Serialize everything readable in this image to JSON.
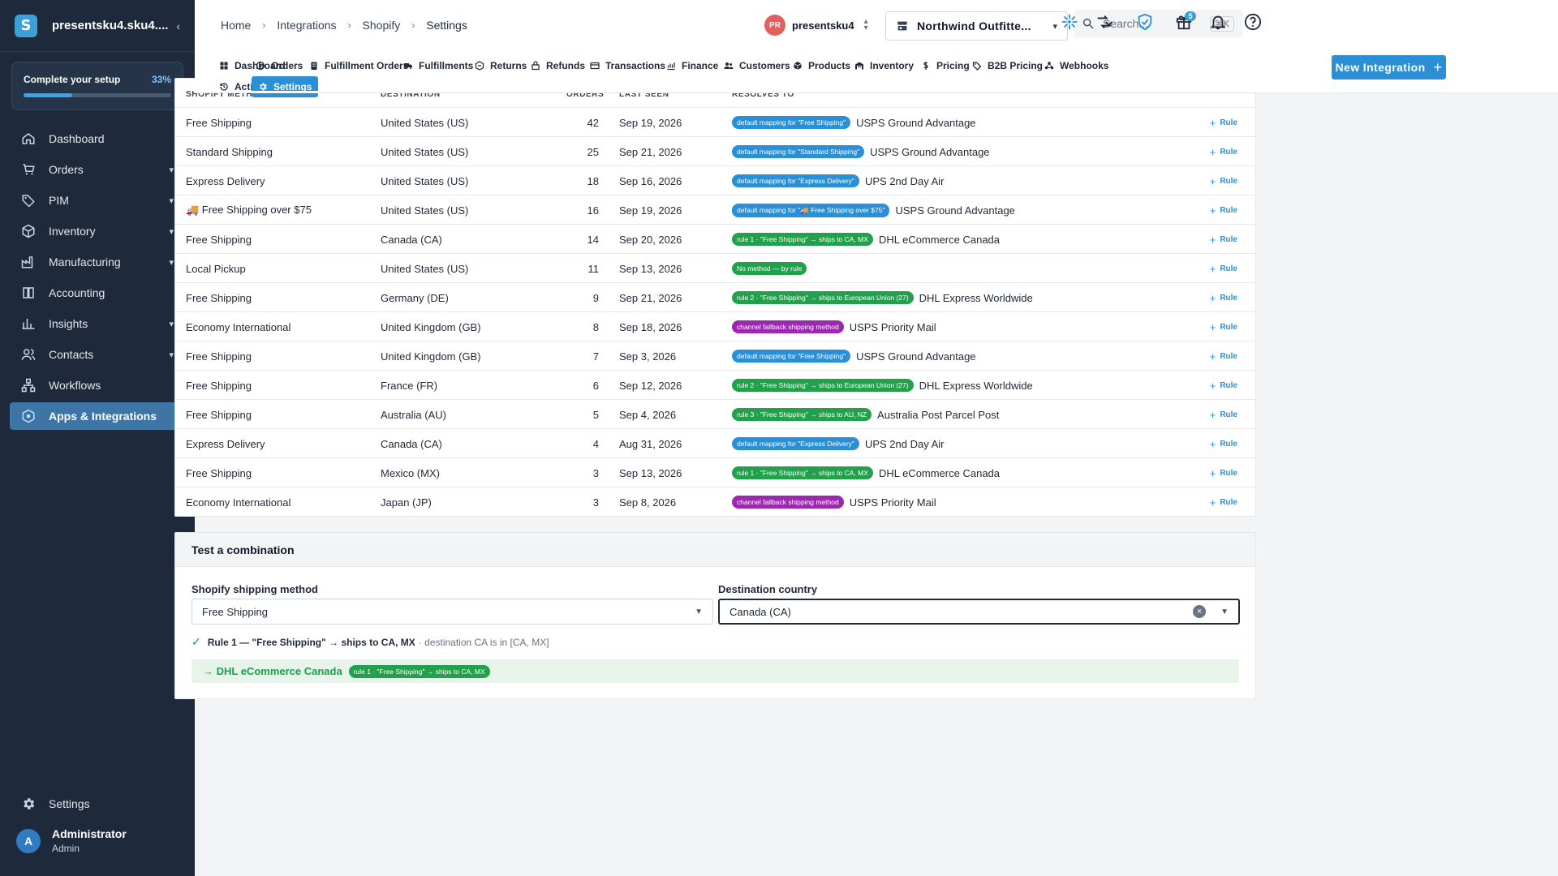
{
  "sidebar": {
    "logo_letter": "S",
    "org_name": "presentsku4.sku4....",
    "setup": {
      "label": "Complete your setup",
      "percent_label": "33%",
      "progress": 0.33
    },
    "items": [
      {
        "label": "Dashboard",
        "icon": "home-icon",
        "has_chevron": false,
        "active": false
      },
      {
        "label": "Orders",
        "icon": "cart-icon",
        "has_chevron": true,
        "active": false
      },
      {
        "label": "PIM",
        "icon": "tag-icon",
        "has_chevron": true,
        "active": false
      },
      {
        "label": "Inventory",
        "icon": "box-icon",
        "has_chevron": true,
        "active": false
      },
      {
        "label": "Manufacturing",
        "icon": "factory-icon",
        "has_chevron": true,
        "active": false
      },
      {
        "label": "Accounting",
        "icon": "book-icon",
        "has_chevron": false,
        "active": false
      },
      {
        "label": "Insights",
        "icon": "chart-icon",
        "has_chevron": true,
        "active": false
      },
      {
        "label": "Contacts",
        "icon": "contacts-icon",
        "has_chevron": true,
        "active": false
      },
      {
        "label": "Workflows",
        "icon": "workflow-icon",
        "has_chevron": false,
        "active": false
      },
      {
        "label": "Apps & Integrations",
        "icon": "apps-icon",
        "has_chevron": false,
        "active": true
      }
    ],
    "settings_label": "Settings",
    "user": {
      "initial": "A",
      "name": "Administrator",
      "role": "Admin"
    }
  },
  "topbar": {
    "breadcrumbs": [
      "Home",
      "Integrations",
      "Shopify",
      "Settings"
    ],
    "account_initials": "PR",
    "account_name": "presentsku4",
    "store_name": "Northwind Outfitte...",
    "search_placeholder": "Search...",
    "search_shortcut": "⌘K",
    "gift_badge": "5"
  },
  "tabs": [
    {
      "label": "Dashboard",
      "icon": "grid-icon",
      "active": false
    },
    {
      "label": "Orders",
      "icon": "orders-icon",
      "active": false
    },
    {
      "label": "Fulfillment Orders",
      "icon": "clipboard-icon",
      "active": false
    },
    {
      "label": "Fulfillments",
      "icon": "truck-icon",
      "active": false
    },
    {
      "label": "Returns",
      "icon": "return-icon",
      "active": false
    },
    {
      "label": "Refunds",
      "icon": "refund-icon",
      "active": false
    },
    {
      "label": "Transactions",
      "icon": "card-icon",
      "active": false
    },
    {
      "label": "Finance",
      "icon": "finance-icon",
      "active": false
    },
    {
      "label": "Customers",
      "icon": "customers-icon",
      "active": false
    },
    {
      "label": "Products",
      "icon": "product-icon",
      "active": false
    },
    {
      "label": "Inventory",
      "icon": "warehouse-icon",
      "active": false
    },
    {
      "label": "Pricing",
      "icon": "dollar-icon",
      "active": false
    },
    {
      "label": "B2B Pricing",
      "icon": "b2b-tag-icon",
      "active": false
    },
    {
      "label": "Webhooks",
      "icon": "webhook-icon",
      "active": false
    },
    {
      "label": "Activity Log",
      "icon": "history-icon",
      "active": false
    },
    {
      "label": "Settings",
      "icon": "gear-icon",
      "active": true
    }
  ],
  "new_integration_label": "New Integration",
  "table": {
    "headers": [
      "SHOPIFY METHOD",
      "DESTINATION",
      "ORDERS",
      "LAST SEEN",
      "RESOLVES TO"
    ],
    "rule_label": "Rule",
    "rows": [
      {
        "method": "Free Shipping",
        "destination": "United States (US)",
        "orders": "42",
        "last_seen": "Sep 19, 2026",
        "badge": "default mapping for \"Free Shipping\"",
        "badge_kind": "default",
        "service": "USPS Ground Advantage"
      },
      {
        "method": "Standard Shipping",
        "destination": "United States (US)",
        "orders": "25",
        "last_seen": "Sep 21, 2026",
        "badge": "default mapping for \"Standard Shipping\"",
        "badge_kind": "default",
        "service": "USPS Ground Advantage"
      },
      {
        "method": "Express Delivery",
        "destination": "United States (US)",
        "orders": "18",
        "last_seen": "Sep 16, 2026",
        "badge": "default mapping for \"Express Delivery\"",
        "badge_kind": "default",
        "service": "UPS 2nd Day Air"
      },
      {
        "method": "🚚 Free Shipping over $75",
        "destination": "United States (US)",
        "orders": "16",
        "last_seen": "Sep 19, 2026",
        "badge": "default mapping for \"🚚 Free Shipping over $75\"",
        "badge_kind": "default",
        "service": "USPS Ground Advantage"
      },
      {
        "method": "Free Shipping",
        "destination": "Canada (CA)",
        "orders": "14",
        "last_seen": "Sep 20, 2026",
        "badge": "rule 1 · \"Free Shipping\" → ships to CA, MX",
        "badge_kind": "rule",
        "service": "DHL eCommerce Canada"
      },
      {
        "method": "Local Pickup",
        "destination": "United States (US)",
        "orders": "11",
        "last_seen": "Sep 13, 2026",
        "badge": "No method — by rule",
        "badge_kind": "rule",
        "service": ""
      },
      {
        "method": "Free Shipping",
        "destination": "Germany (DE)",
        "orders": "9",
        "last_seen": "Sep 21, 2026",
        "badge": "rule 2 · \"Free Shipping\" → ships to European Union (27)",
        "badge_kind": "rule",
        "service": "DHL Express Worldwide"
      },
      {
        "method": "Economy International",
        "destination": "United Kingdom (GB)",
        "orders": "8",
        "last_seen": "Sep 18, 2026",
        "badge": "channel fallback shipping method",
        "badge_kind": "fallback",
        "service": "USPS Priority Mail"
      },
      {
        "method": "Free Shipping",
        "destination": "United Kingdom (GB)",
        "orders": "7",
        "last_seen": "Sep 3, 2026",
        "badge": "default mapping for \"Free Shipping\"",
        "badge_kind": "default",
        "service": "USPS Ground Advantage"
      },
      {
        "method": "Free Shipping",
        "destination": "France (FR)",
        "orders": "6",
        "last_seen": "Sep 12, 2026",
        "badge": "rule 2 · \"Free Shipping\" → ships to European Union (27)",
        "badge_kind": "rule",
        "service": "DHL Express Worldwide"
      },
      {
        "method": "Free Shipping",
        "destination": "Australia (AU)",
        "orders": "5",
        "last_seen": "Sep 4, 2026",
        "badge": "rule 3 · \"Free Shipping\" → ships to AU, NZ",
        "badge_kind": "rule",
        "service": "Australia Post Parcel Post"
      },
      {
        "method": "Express Delivery",
        "destination": "Canada (CA)",
        "orders": "4",
        "last_seen": "Aug 31, 2026",
        "badge": "default mapping for \"Express Delivery\"",
        "badge_kind": "default",
        "service": "UPS 2nd Day Air"
      },
      {
        "method": "Free Shipping",
        "destination": "Mexico (MX)",
        "orders": "3",
        "last_seen": "Sep 13, 2026",
        "badge": "rule 1 · \"Free Shipping\" → ships to CA, MX",
        "badge_kind": "rule",
        "service": "DHL eCommerce Canada"
      },
      {
        "method": "Economy International",
        "destination": "Japan (JP)",
        "orders": "3",
        "last_seen": "Sep 8, 2026",
        "badge": "channel fallback shipping method",
        "badge_kind": "fallback",
        "service": "USPS Priority Mail"
      }
    ]
  },
  "test": {
    "title": "Test a combination",
    "method_label": "Shopify shipping method",
    "method_value": "Free Shipping",
    "country_label": "Destination country",
    "country_value": "Canada (CA)",
    "match_rule": "Rule 1 — \"Free Shipping\" → ships to CA, MX",
    "match_detail": "· destination CA is in [CA, MX]",
    "result_text": "→ DHL eCommerce Canada",
    "result_badge": "rule 1 · \"Free Shipping\" → ships to CA, MX"
  },
  "colors": {
    "badge_default": "#2b8fd6",
    "badge_rule": "#22a04b",
    "badge_fallback": "#9c27b0",
    "accent": "#2b8fd6",
    "sidebar_bg": "#1e2a3b"
  }
}
